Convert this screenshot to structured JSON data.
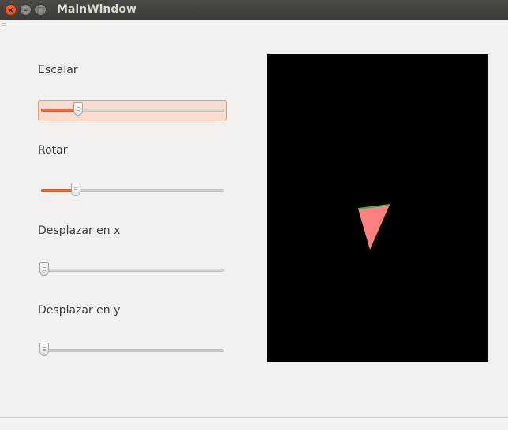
{
  "window": {
    "title": "MainWindow"
  },
  "controls": [
    {
      "label": "Escalar",
      "value_percent": 19,
      "focused": true
    },
    {
      "label": "Rotar",
      "value_percent": 18,
      "focused": false
    },
    {
      "label": "Desplazar en x",
      "value_percent": 0,
      "focused": false
    },
    {
      "label": "Desplazar en y",
      "value_percent": 0,
      "focused": false
    }
  ],
  "colors": {
    "accent": "#e8713e",
    "canvas_background": "#000000",
    "shape_fill": "#ff8080",
    "shape_edge": "#3fae49"
  }
}
